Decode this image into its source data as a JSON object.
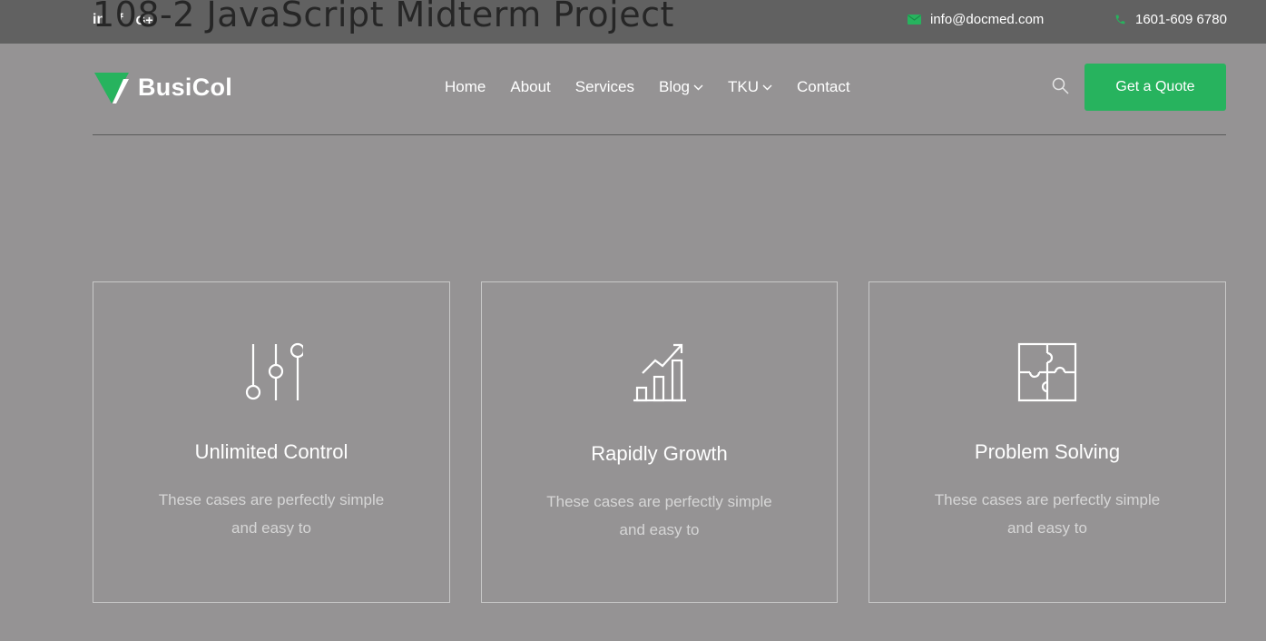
{
  "page_title": "108-2 JavaScript Midterm Project",
  "topbar": {
    "socials": [
      {
        "icon": "linkedin-icon",
        "glyph": "in"
      },
      {
        "icon": "facebook-icon",
        "glyph": "f"
      },
      {
        "icon": "google-plus-icon",
        "glyph": "G+"
      }
    ],
    "email": "info@docmed.com",
    "phone": "1601-609 6780"
  },
  "logo": {
    "text": "BusiCol"
  },
  "nav": {
    "items": [
      {
        "label": "Home"
      },
      {
        "label": "About"
      },
      {
        "label": "Services"
      },
      {
        "label": "Blog",
        "dropdown": true
      },
      {
        "label": "TKU",
        "dropdown": true
      },
      {
        "label": "Contact"
      }
    ]
  },
  "header": {
    "quote_label": "Get a Quote"
  },
  "features": [
    {
      "icon": "sliders-icon",
      "title": "Unlimited Control",
      "desc": "These cases are perfectly simple and easy to"
    },
    {
      "icon": "growth-chart-icon",
      "title": "Rapidly Growth",
      "desc": "These cases are perfectly simple and easy to"
    },
    {
      "icon": "puzzle-icon",
      "title": "Problem Solving",
      "desc": "These cases are perfectly simple and easy to"
    }
  ],
  "colors": {
    "accent": "#27b35e",
    "topbar": "#616161",
    "background": "#959394"
  }
}
